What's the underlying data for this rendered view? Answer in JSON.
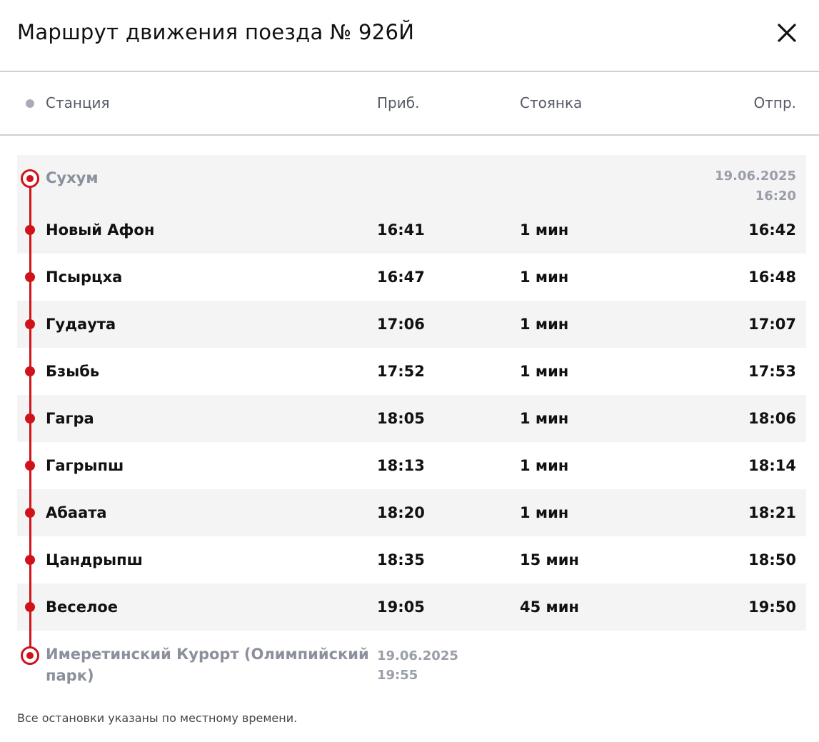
{
  "title": "Маршрут движения поезда № 926Й",
  "columns": {
    "station": "Станция",
    "arrival": "Приб.",
    "stop": "Стоянка",
    "departure": "Отпр."
  },
  "origin": {
    "name": "Сухум",
    "dep_date": "19.06.2025",
    "dep_time": "16:20"
  },
  "stops": [
    {
      "name": "Новый Афон",
      "arrival": "16:41",
      "stop": "1 мин",
      "departure": "16:42"
    },
    {
      "name": "Псырцха",
      "arrival": "16:47",
      "stop": "1 мин",
      "departure": "16:48"
    },
    {
      "name": "Гудаута",
      "arrival": "17:06",
      "stop": "1 мин",
      "departure": "17:07"
    },
    {
      "name": "Бзыбь",
      "arrival": "17:52",
      "stop": "1 мин",
      "departure": "17:53"
    },
    {
      "name": "Гагра",
      "arrival": "18:05",
      "stop": "1 мин",
      "departure": "18:06"
    },
    {
      "name": "Гагрыпш",
      "arrival": "18:13",
      "stop": "1 мин",
      "departure": "18:14"
    },
    {
      "name": "Абаата",
      "arrival": "18:20",
      "stop": "1 мин",
      "departure": "18:21"
    },
    {
      "name": "Цандрыпш",
      "arrival": "18:35",
      "stop": "15 мин",
      "departure": "18:50"
    },
    {
      "name": "Веселое",
      "arrival": "19:05",
      "stop": "45 мин",
      "departure": "19:50"
    }
  ],
  "destination": {
    "name_line1": "Имеретинский Курорт (Олимпийский",
    "name_line2": "парк)",
    "arr_date": "19.06.2025",
    "arr_time": "19:55"
  },
  "footnote": "Все остановки указаны по местному времени.",
  "colors": {
    "accent": "#d0121b",
    "row_shade": "#f4f4f5",
    "muted": "#8c909c"
  },
  "icons": {
    "close": "close-icon",
    "station_marker": "station-dot-icon",
    "terminal_marker": "terminal-station-icon"
  }
}
